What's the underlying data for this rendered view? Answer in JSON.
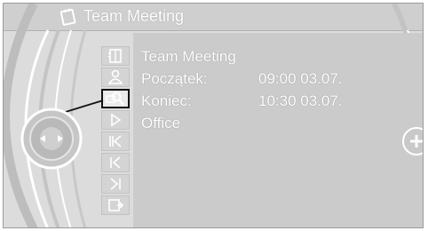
{
  "window": {
    "title": "Team Meeting",
    "title_icon": "notepad-icon"
  },
  "details": {
    "subject": "Team Meeting",
    "start_label": "Początek:",
    "start_value": "09:00 03.07.",
    "end_label": "Koniec:",
    "end_value": "10:30 03.07.",
    "location": "Office"
  },
  "menu": {
    "items": [
      {
        "name": "contacts-book-icon"
      },
      {
        "name": "person-icon"
      },
      {
        "name": "search-zoom-icon",
        "selected": true
      },
      {
        "name": "play-icon"
      },
      {
        "name": "skip-back-icon"
      },
      {
        "name": "previous-icon"
      },
      {
        "name": "next-icon"
      },
      {
        "name": "exit-icon"
      }
    ]
  },
  "controller": {
    "icon": "controller-knob-icon"
  },
  "plus_button": {
    "icon": "plus-icon"
  }
}
